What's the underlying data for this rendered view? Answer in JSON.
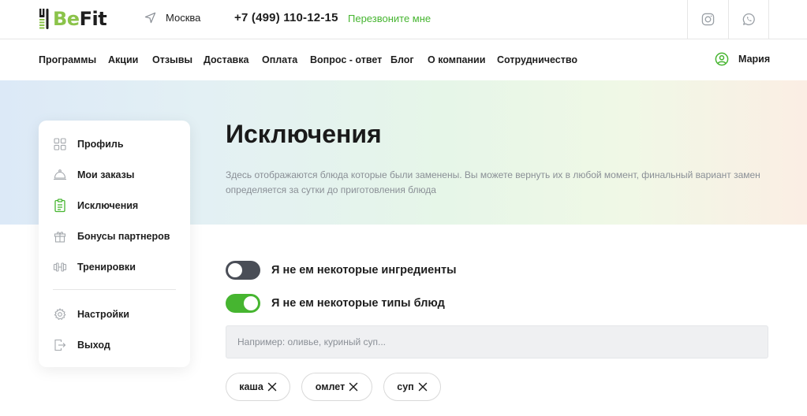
{
  "header": {
    "logo": {
      "part1": "Be",
      "part2": "Fit"
    },
    "city": "Москва",
    "phone": "+7 (499) 110-12-15",
    "callback": "Перезвоните мне",
    "social": [
      {
        "icon": "instagram-icon"
      },
      {
        "icon": "whatsapp-icon"
      }
    ]
  },
  "nav": {
    "items": [
      "Программы",
      "Акции",
      "Отзывы",
      "Доставка",
      "Оплата",
      "Вопрос - ответ",
      "Блог",
      "О компании",
      "Сотрудничество"
    ],
    "user": "Мария"
  },
  "sidebar": {
    "items": [
      {
        "label": "Профиль",
        "icon": "grid-icon"
      },
      {
        "label": "Мои заказы",
        "icon": "cloche-icon"
      },
      {
        "label": "Исключения",
        "icon": "clipboard-icon",
        "active": true
      },
      {
        "label": "Бонусы партнеров",
        "icon": "gift-icon"
      },
      {
        "label": "Тренировки",
        "icon": "dumbbell-icon"
      },
      {
        "label": "Настройки",
        "icon": "gear-icon"
      },
      {
        "label": "Выход",
        "icon": "exit-icon"
      }
    ]
  },
  "main": {
    "title": "Исключения",
    "description": "Здесь отображаются блюда которые были заменены. Вы можете вернуть их в любой момент, финальный вариант замен определяется за сутки до приготовления блюда",
    "toggles": [
      {
        "label": "Я не ем некоторые ингредиенты",
        "on": false
      },
      {
        "label": "Я не ем некоторые типы блюд",
        "on": true
      }
    ],
    "search": {
      "placeholder": "Например: оливье, куриный суп...",
      "value": ""
    },
    "chips": [
      "каша",
      "омлет",
      "суп"
    ]
  },
  "colors": {
    "accent": "#46b530",
    "text": "#1e1e1e",
    "muted": "#8a8f96",
    "toggle_off": "#4a4e57"
  }
}
